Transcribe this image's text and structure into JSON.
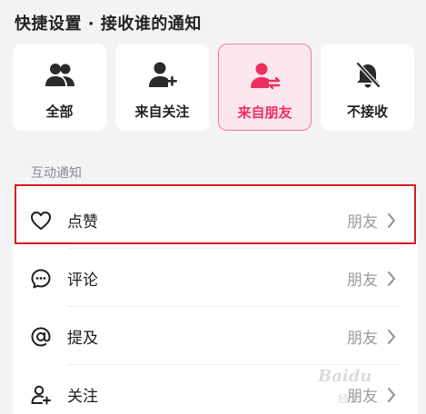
{
  "quick_settings": {
    "title": "快捷设置 · 接收谁的通知",
    "options": [
      {
        "label": "全部",
        "icon": "group-icon",
        "selected": false
      },
      {
        "label": "来自关注",
        "icon": "user-add-icon",
        "selected": false
      },
      {
        "label": "来自朋友",
        "icon": "user-switch-icon",
        "selected": true
      },
      {
        "label": "不接收",
        "icon": "bell-off-icon",
        "selected": false
      }
    ]
  },
  "interaction": {
    "section_title": "互动通知",
    "rows": [
      {
        "label": "点赞",
        "value": "朋友",
        "icon": "heart-icon"
      },
      {
        "label": "评论",
        "value": "朋友",
        "icon": "comment-icon"
      },
      {
        "label": "提及",
        "value": "朋友",
        "icon": "at-icon"
      },
      {
        "label": "关注",
        "value": "朋友",
        "icon": "user-follow-icon"
      }
    ]
  },
  "watermark": {
    "text": "Baidu",
    "sub": "经验"
  },
  "colors": {
    "accent": "#ee2f60",
    "selected_bg": "#fde7ee",
    "highlight_border": "#d21d24",
    "page_bg": "#f3f3f5",
    "muted_text": "#9a9aa0"
  }
}
